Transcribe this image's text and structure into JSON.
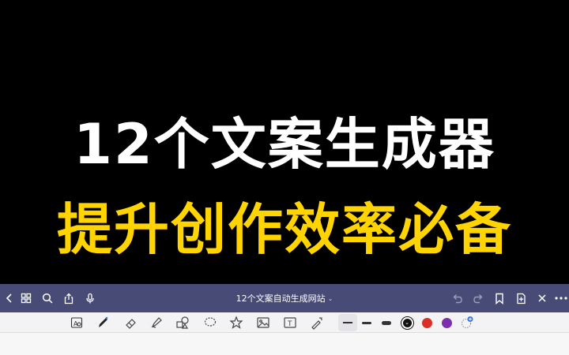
{
  "hero": {
    "line1": "12个文案生成器",
    "line2": "提升创作效率必备",
    "line1_color": "#ffffff",
    "line2_color": "#ffd400"
  },
  "navbar": {
    "title": "12个文案自动生成网站",
    "background": "#474b75",
    "left_icons": [
      "back-icon",
      "grid-icon",
      "search-icon",
      "share-icon",
      "microphone-icon"
    ],
    "right_icons": [
      "undo-icon",
      "redo-icon",
      "bookmark-icon",
      "add-page-icon",
      "close-icon",
      "more-icon"
    ]
  },
  "toolbar": {
    "tools": [
      "lasso-text-icon",
      "pen-icon",
      "eraser-icon",
      "highlighter-icon",
      "shapes-icon",
      "lasso-icon",
      "sticker-icon",
      "image-icon",
      "text-box-icon",
      "laser-pointer-icon"
    ],
    "stroke_widths": [
      "thin",
      "medium",
      "thick"
    ],
    "colors": [
      "#111111",
      "#d93025",
      "#7b2fa8"
    ],
    "selected_color": "#111111"
  }
}
